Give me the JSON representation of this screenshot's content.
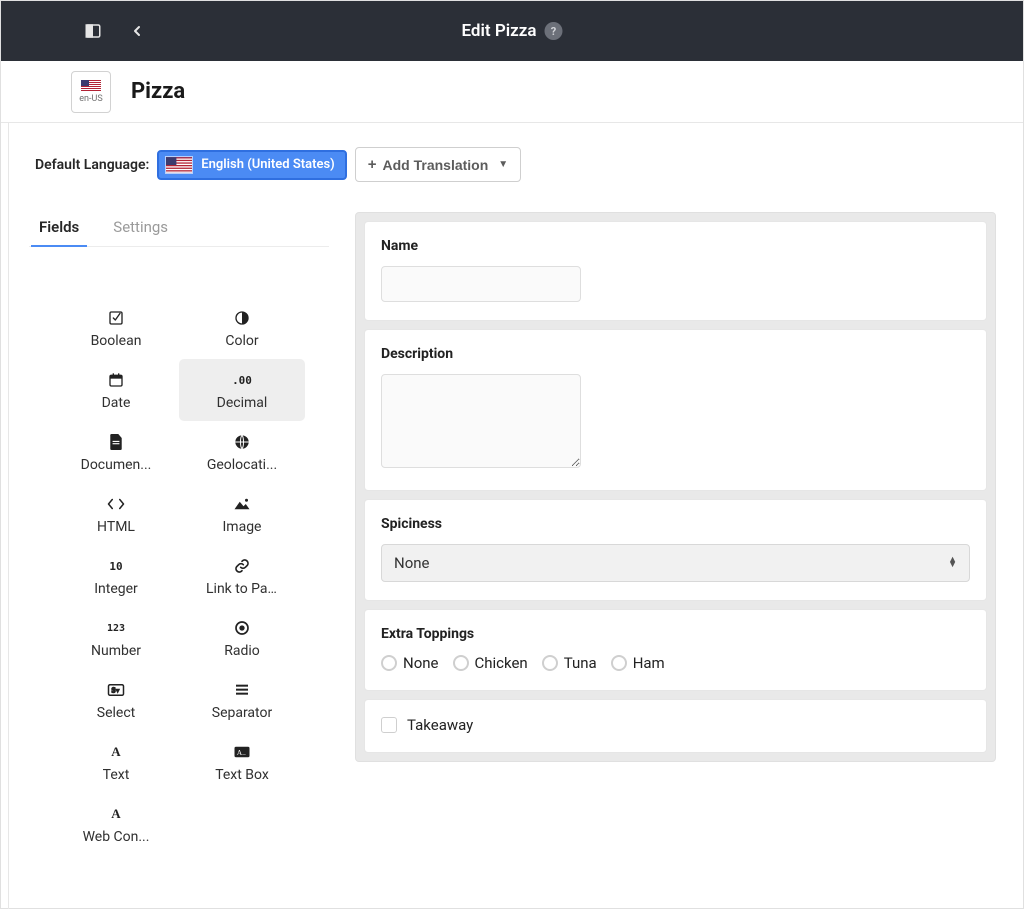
{
  "header": {
    "title": "Edit Pizza"
  },
  "locale": {
    "code": "en-US"
  },
  "page_title": "Pizza",
  "lang": {
    "label": "Default Language:",
    "current": "English (United States)",
    "add_btn": "Add Translation"
  },
  "tabs": {
    "fields": "Fields",
    "settings": "Settings"
  },
  "field_types": {
    "boolean": "Boolean",
    "color": "Color",
    "date": "Date",
    "decimal": "Decimal",
    "documents": "Documen...",
    "geolocation": "Geolocati...",
    "html": "HTML",
    "image": "Image",
    "integer": "Integer",
    "link_to_page": "Link to Pa...",
    "number": "Number",
    "radio": "Radio",
    "select": "Select",
    "separator": "Separator",
    "text": "Text",
    "textbox": "Text Box",
    "webcontent": "Web Con..."
  },
  "form": {
    "name_label": "Name",
    "description_label": "Description",
    "spiciness_label": "Spiciness",
    "spiciness_value": "None",
    "extra_toppings_label": "Extra Toppings",
    "toppings": {
      "none": "None",
      "chicken": "Chicken",
      "tuna": "Tuna",
      "ham": "Ham"
    },
    "takeaway_label": "Takeaway"
  }
}
